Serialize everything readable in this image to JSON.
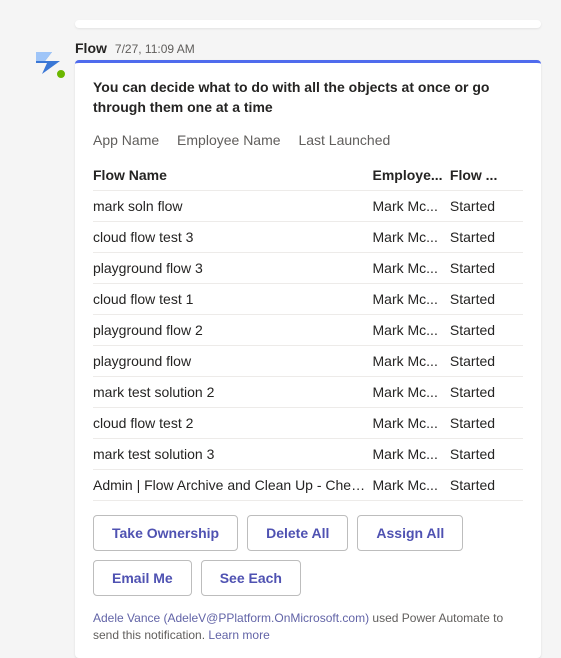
{
  "sender": "Flow",
  "timestamp": "7/27, 11:09 AM",
  "card": {
    "title": "You can decide what to do with all the objects at once or go through them one at a time",
    "meta": {
      "app_name_label": "App Name",
      "employee_name_label": "Employee Name",
      "last_launched_label": "Last Launched"
    },
    "table": {
      "headers": {
        "flow_name": "Flow Name",
        "employee": "Employe...",
        "state": "Flow ..."
      },
      "rows": [
        {
          "name": "mark soln flow",
          "employee": "Mark Mc...",
          "state": "Started"
        },
        {
          "name": "cloud flow test 3",
          "employee": "Mark Mc...",
          "state": "Started"
        },
        {
          "name": "playground flow 3",
          "employee": "Mark Mc...",
          "state": "Started"
        },
        {
          "name": "cloud flow test 1",
          "employee": "Mark Mc...",
          "state": "Started"
        },
        {
          "name": "playground flow 2",
          "employee": "Mark Mc...",
          "state": "Started"
        },
        {
          "name": "playground flow",
          "employee": "Mark Mc...",
          "state": "Started"
        },
        {
          "name": "mark test solution 2",
          "employee": "Mark Mc...",
          "state": "Started"
        },
        {
          "name": "cloud flow test 2",
          "employee": "Mark Mc...",
          "state": "Started"
        },
        {
          "name": "mark test solution 3",
          "employee": "Mark Mc...",
          "state": "Started"
        },
        {
          "name": "Admin | Flow Archive and Clean Up - Chec...",
          "employee": "Mark Mc...",
          "state": "Started"
        }
      ]
    },
    "actions": {
      "take_ownership": "Take Ownership",
      "delete_all": "Delete All",
      "assign_all": "Assign All",
      "email_me": "Email Me",
      "see_each": "See Each"
    },
    "footnote": {
      "user_link": "Adele Vance (AdeleV@PPlatform.OnMicrosoft.com)",
      "text_mid": " used Power Automate to send this notification. ",
      "learn_more": "Learn more"
    }
  }
}
